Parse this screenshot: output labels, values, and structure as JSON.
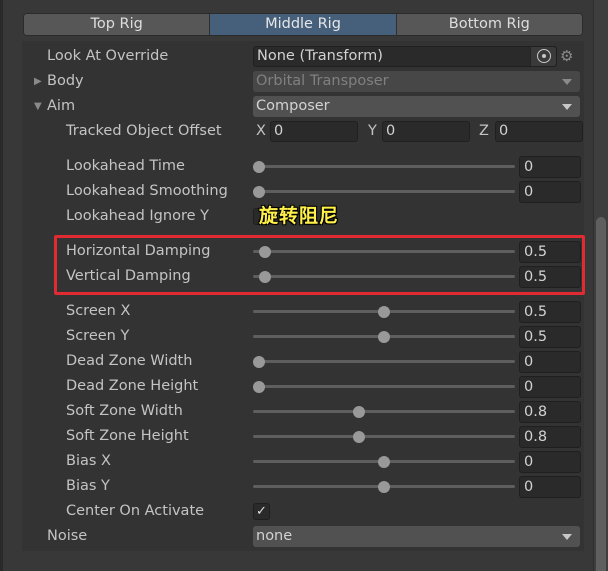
{
  "tabs": [
    {
      "label": "Top Rig",
      "active": false
    },
    {
      "label": "Middle Rig",
      "active": true
    },
    {
      "label": "Bottom Rig",
      "active": false
    }
  ],
  "look_at_override": {
    "label": "Look At Override",
    "value": "None (Transform)"
  },
  "body": {
    "label": "Body",
    "value": "Orbital Transposer",
    "expanded": false
  },
  "aim": {
    "label": "Aim",
    "value": "Composer",
    "expanded": true
  },
  "tracked_object_offset": {
    "label": "Tracked Object Offset",
    "x_label": "X",
    "x": "0",
    "y_label": "Y",
    "y": "0",
    "z_label": "Z",
    "z": "0"
  },
  "sliders": [
    {
      "label": "Lookahead Time",
      "value": "0",
      "fraction": 0.0
    },
    {
      "label": "Lookahead Smoothing",
      "value": "0",
      "fraction": 0.0
    },
    {
      "label": "Horizontal Damping",
      "value": "0.5",
      "fraction": 0.025
    },
    {
      "label": "Vertical Damping",
      "value": "0.5",
      "fraction": 0.025
    },
    {
      "label": "Screen X",
      "value": "0.5",
      "fraction": 0.5
    },
    {
      "label": "Screen Y",
      "value": "0.5",
      "fraction": 0.5
    },
    {
      "label": "Dead Zone Width",
      "value": "0",
      "fraction": 0.0
    },
    {
      "label": "Dead Zone Height",
      "value": "0",
      "fraction": 0.0
    },
    {
      "label": "Soft Zone Width",
      "value": "0.8",
      "fraction": 0.4
    },
    {
      "label": "Soft Zone Height",
      "value": "0.8",
      "fraction": 0.4
    },
    {
      "label": "Bias X",
      "value": "0",
      "fraction": 0.5
    },
    {
      "label": "Bias Y",
      "value": "0",
      "fraction": 0.5
    }
  ],
  "lookahead_ignore_y": {
    "label": "Lookahead Ignore Y",
    "checked": false
  },
  "center_on_activate": {
    "label": "Center On Activate",
    "checked": true,
    "check_glyph": "✓"
  },
  "noise": {
    "label": "Noise",
    "value": "none"
  },
  "annotation": {
    "text": "旋转阻尼",
    "color": "#fff14a"
  },
  "highlight_color": "#e02b33",
  "icons": {
    "gear": "⚙",
    "foldout_collapsed": "▶",
    "foldout_expanded": "▼"
  }
}
